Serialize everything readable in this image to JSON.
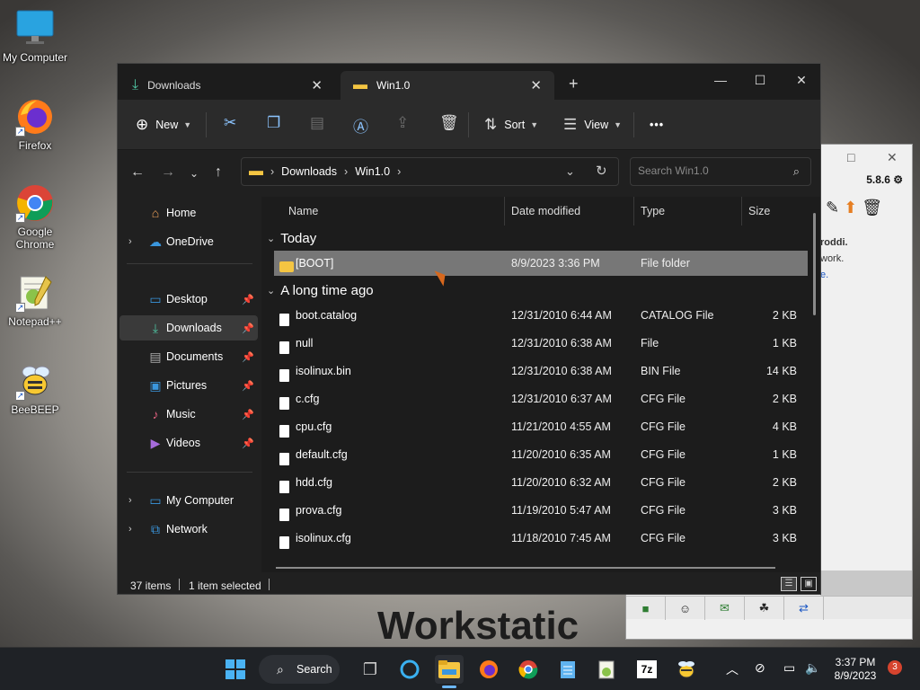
{
  "desktop": {
    "icons": [
      {
        "label": "My Computer",
        "icon": "monitor-icon"
      },
      {
        "label": "Firefox",
        "icon": "firefox-icon"
      },
      {
        "label": "Google Chrome",
        "icon": "chrome-icon"
      },
      {
        "label": "Notepad++",
        "icon": "notepad-plus-plus-icon"
      },
      {
        "label": "BeeBEEP",
        "icon": "bee-icon"
      }
    ],
    "wallpaper_text": "Workstatic"
  },
  "background_window": {
    "version": "5.8.6",
    "body_lines": [
      "roddi.",
      "work.",
      "e."
    ]
  },
  "explorer": {
    "tabs": [
      {
        "label": "Downloads",
        "icon": "download-icon"
      },
      {
        "label": "Win1.0",
        "icon": "folder-icon"
      }
    ],
    "toolbar": {
      "new_label": "New",
      "sort_label": "Sort",
      "view_label": "View",
      "more_label": "•••"
    },
    "address": {
      "segments": [
        "Downloads",
        "Win1.0"
      ],
      "search_placeholder": "Search Win1.0"
    },
    "nav": {
      "home": "Home",
      "onedrive": "OneDrive",
      "desktop": "Desktop",
      "downloads": "Downloads",
      "documents": "Documents",
      "pictures": "Pictures",
      "music": "Music",
      "videos": "Videos",
      "my_computer": "My Computer",
      "network": "Network"
    },
    "columns": {
      "name": "Name",
      "date": "Date modified",
      "type": "Type",
      "size": "Size"
    },
    "groups": {
      "today": "Today",
      "long_ago": "A long time ago"
    },
    "today_rows": [
      {
        "name": "[BOOT]",
        "date": "8/9/2023 3:36 PM",
        "type": "File folder",
        "size": ""
      }
    ],
    "old_rows": [
      {
        "name": "boot.catalog",
        "date": "12/31/2010 6:44 AM",
        "type": "CATALOG File",
        "size": "2 KB"
      },
      {
        "name": "null",
        "date": "12/31/2010 6:38 AM",
        "type": "File",
        "size": "1 KB"
      },
      {
        "name": "isolinux.bin",
        "date": "12/31/2010 6:38 AM",
        "type": "BIN File",
        "size": "14 KB"
      },
      {
        "name": "c.cfg",
        "date": "12/31/2010 6:37 AM",
        "type": "CFG File",
        "size": "2 KB"
      },
      {
        "name": "cpu.cfg",
        "date": "11/21/2010 4:55 AM",
        "type": "CFG File",
        "size": "4 KB"
      },
      {
        "name": "default.cfg",
        "date": "11/20/2010 6:35 AM",
        "type": "CFG File",
        "size": "1 KB"
      },
      {
        "name": "hdd.cfg",
        "date": "11/20/2010 6:32 AM",
        "type": "CFG File",
        "size": "2 KB"
      },
      {
        "name": "prova.cfg",
        "date": "11/19/2010 5:47 AM",
        "type": "CFG File",
        "size": "3 KB"
      },
      {
        "name": "isolinux.cfg",
        "date": "11/18/2010 7:45 AM",
        "type": "CFG File",
        "size": "3 KB"
      }
    ],
    "status": {
      "items": "37 items",
      "selected": "1 item selected"
    }
  },
  "taskbar": {
    "search_label": "Search",
    "time": "3:37 PM",
    "date": "8/9/2023",
    "notification_count": "3"
  }
}
